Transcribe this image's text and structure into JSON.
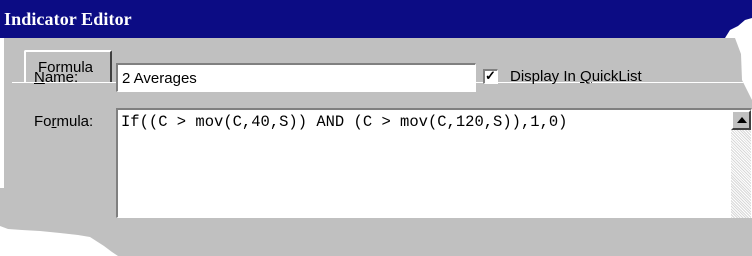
{
  "window": {
    "title": "Indicator Editor"
  },
  "tabs": [
    {
      "label": "Formula"
    }
  ],
  "name": {
    "label": "Name:",
    "value": "2 Averages"
  },
  "quicklist": {
    "label": "Display In QuickList",
    "checked": true
  },
  "formula": {
    "label": "Formula:",
    "value": "If((C > mov(C,40,S)) AND (C > mov(C,120,S)),1,0)"
  },
  "icons": {
    "scroll_up": "arrow-up-icon",
    "check": "checkmark-icon"
  }
}
